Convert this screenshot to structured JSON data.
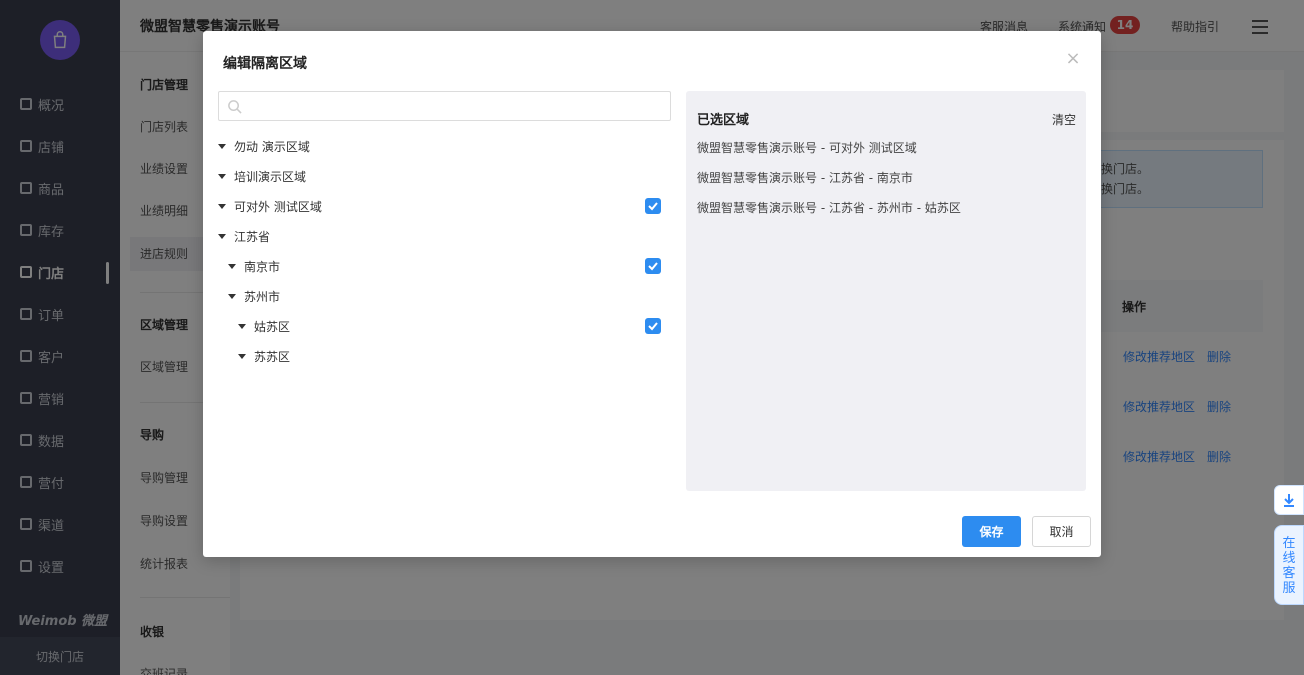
{
  "topbar": {
    "account": "微盟智慧零售演示账号",
    "links": [
      "客服消息",
      "系统通知",
      "帮助指引"
    ],
    "notice_count": "14"
  },
  "sidebar": {
    "items": [
      {
        "label": "概况",
        "icon": "dashboard-icon"
      },
      {
        "label": "店铺",
        "icon": "shop-icon"
      },
      {
        "label": "商品",
        "icon": "goods-icon"
      },
      {
        "label": "库存",
        "icon": "inventory-icon"
      },
      {
        "label": "门店",
        "icon": "store-icon",
        "active": true
      },
      {
        "label": "订单",
        "icon": "order-icon"
      },
      {
        "label": "客户",
        "icon": "customer-icon"
      },
      {
        "label": "营销",
        "icon": "marketing-icon"
      },
      {
        "label": "数据",
        "icon": "data-icon"
      },
      {
        "label": "营付",
        "icon": "pay-icon"
      },
      {
        "label": "渠道",
        "icon": "channel-icon"
      },
      {
        "label": "设置",
        "icon": "settings-icon"
      }
    ],
    "brand": "Weimob 微盟",
    "switch_store": "切换门店"
  },
  "subnav": {
    "groups": [
      {
        "title": "门店管理",
        "items": [
          "门店列表",
          "业绩设置",
          "业绩明细",
          "进店规则"
        ]
      },
      {
        "title": "区域管理",
        "items": [
          "区域管理"
        ]
      },
      {
        "title": "导购",
        "items": [
          "导购管理",
          "导购设置",
          "统计报表"
        ]
      },
      {
        "title": "收银",
        "items": [
          "交班记录"
        ]
      }
    ]
  },
  "background": {
    "info_lines": [
      "换门店。",
      "换门店。"
    ],
    "table_header": "操作",
    "row_actions": [
      "修改推荐地区",
      "删除"
    ]
  },
  "floating": {
    "customer_service": "在线客服"
  },
  "dialog": {
    "title": "编辑隔离区域",
    "search_placeholder": "",
    "tree": [
      {
        "label": "勿动 演示区域",
        "level": 0,
        "checked": false
      },
      {
        "label": "培训演示区域",
        "level": 0,
        "checked": false
      },
      {
        "label": "可对外 测试区域",
        "level": 0,
        "checked": true
      },
      {
        "label": "江苏省",
        "level": 0,
        "checked": false
      },
      {
        "label": "南京市",
        "level": 1,
        "checked": true
      },
      {
        "label": "苏州市",
        "level": 1,
        "checked": false
      },
      {
        "label": "姑苏区",
        "level": 2,
        "checked": true
      },
      {
        "label": "苏苏区",
        "level": 2,
        "checked": false
      }
    ],
    "selected_title": "已选区域",
    "clear_label": "清空",
    "selected": [
      "微盟智慧零售演示账号 - 可对外 测试区域",
      "微盟智慧零售演示账号 - 江苏省 - 南京市",
      "微盟智慧零售演示账号 - 江苏省 - 苏州市 - 姑苏区"
    ],
    "save_label": "保存",
    "cancel_label": "取消"
  },
  "colors": {
    "primary": "#2d8cf0",
    "sidebar_bg": "#3b3f4e",
    "badge": "#e64340"
  }
}
